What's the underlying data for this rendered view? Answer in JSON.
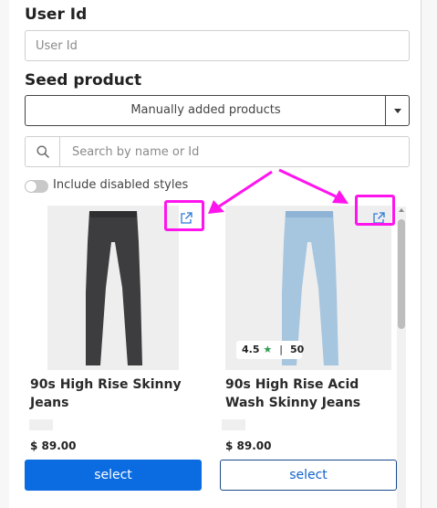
{
  "form": {
    "user_id_label": "User Id",
    "user_id_placeholder": "User Id",
    "user_id_value": "",
    "seed_label": "Seed product",
    "seed_selected": "Manually added products",
    "search_placeholder": "Search by name or Id",
    "search_value": "",
    "include_disabled_label": "Include disabled styles",
    "include_disabled_on": false
  },
  "products": [
    {
      "title": "90s High Rise Skinny Jeans",
      "price": "$ 89.00",
      "button_label": "select",
      "button_style": "primary",
      "jeans_color": "#3d3d3f"
    },
    {
      "title": "90s High Rise Acid Wash Skinny Jeans",
      "price": "$ 89.00",
      "button_label": "select",
      "button_style": "outline",
      "jeans_color": "#a6c5df",
      "rating": "4.5",
      "review_count": "50"
    }
  ],
  "colors": {
    "primary_button": "#0b6be0",
    "annotation_magenta": "#ff14ee",
    "rating_star": "#2e9b4d",
    "link_icon": "#2c79d6"
  }
}
